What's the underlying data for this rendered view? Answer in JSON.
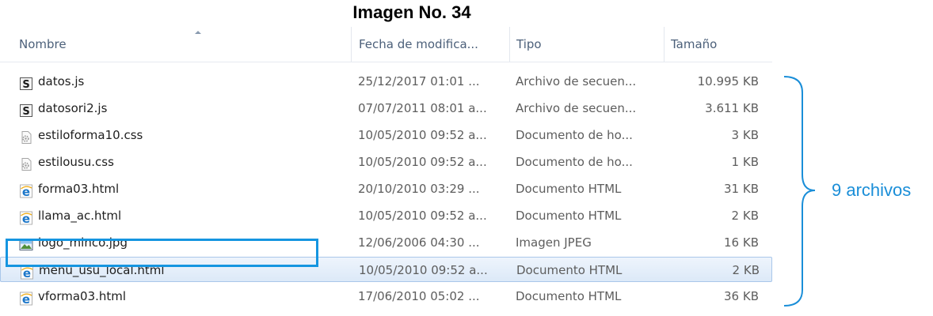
{
  "caption": "Imagen No. 34",
  "columns": {
    "name": "Nombre",
    "date": "Fecha de modifica...",
    "type": "Tipo",
    "size": "Tamaño"
  },
  "files": [
    {
      "name": "datos.js",
      "date": "25/12/2017 01:01 ...",
      "type": "Archivo de secuen...",
      "size": "10.995 KB",
      "icon": "script-icon"
    },
    {
      "name": "datosori2.js",
      "date": "07/07/2011 08:01 a...",
      "type": "Archivo de secuen...",
      "size": "3.611 KB",
      "icon": "script-icon"
    },
    {
      "name": "estiloforma10.css",
      "date": "10/05/2010 09:52 a...",
      "type": "Documento de ho...",
      "size": "3 KB",
      "icon": "css-icon"
    },
    {
      "name": "estilousu.css",
      "date": "10/05/2010 09:52 a...",
      "type": "Documento de ho...",
      "size": "1 KB",
      "icon": "css-icon"
    },
    {
      "name": "forma03.html",
      "date": "20/10/2010 03:29 ...",
      "type": "Documento HTML",
      "size": "31 KB",
      "icon": "ie-html-icon"
    },
    {
      "name": "llama_ac.html",
      "date": "10/05/2010 09:52 a...",
      "type": "Documento HTML",
      "size": "2 KB",
      "icon": "ie-html-icon"
    },
    {
      "name": "logo_minco.jpg",
      "date": "12/06/2006 04:30 ...",
      "type": "Imagen JPEG",
      "size": "16 KB",
      "icon": "image-icon"
    },
    {
      "name": "menu_usu_local.html",
      "date": "10/05/2010 09:52 a...",
      "type": "Documento HTML",
      "size": "2 KB",
      "icon": "ie-html-icon"
    },
    {
      "name": "vforma03.html",
      "date": "17/06/2010 05:02 ...",
      "type": "Documento HTML",
      "size": "36 KB",
      "icon": "ie-html-icon"
    }
  ],
  "selected_index": 7,
  "annotation": {
    "label": "9 archivos",
    "color": "#1a8ed8"
  }
}
